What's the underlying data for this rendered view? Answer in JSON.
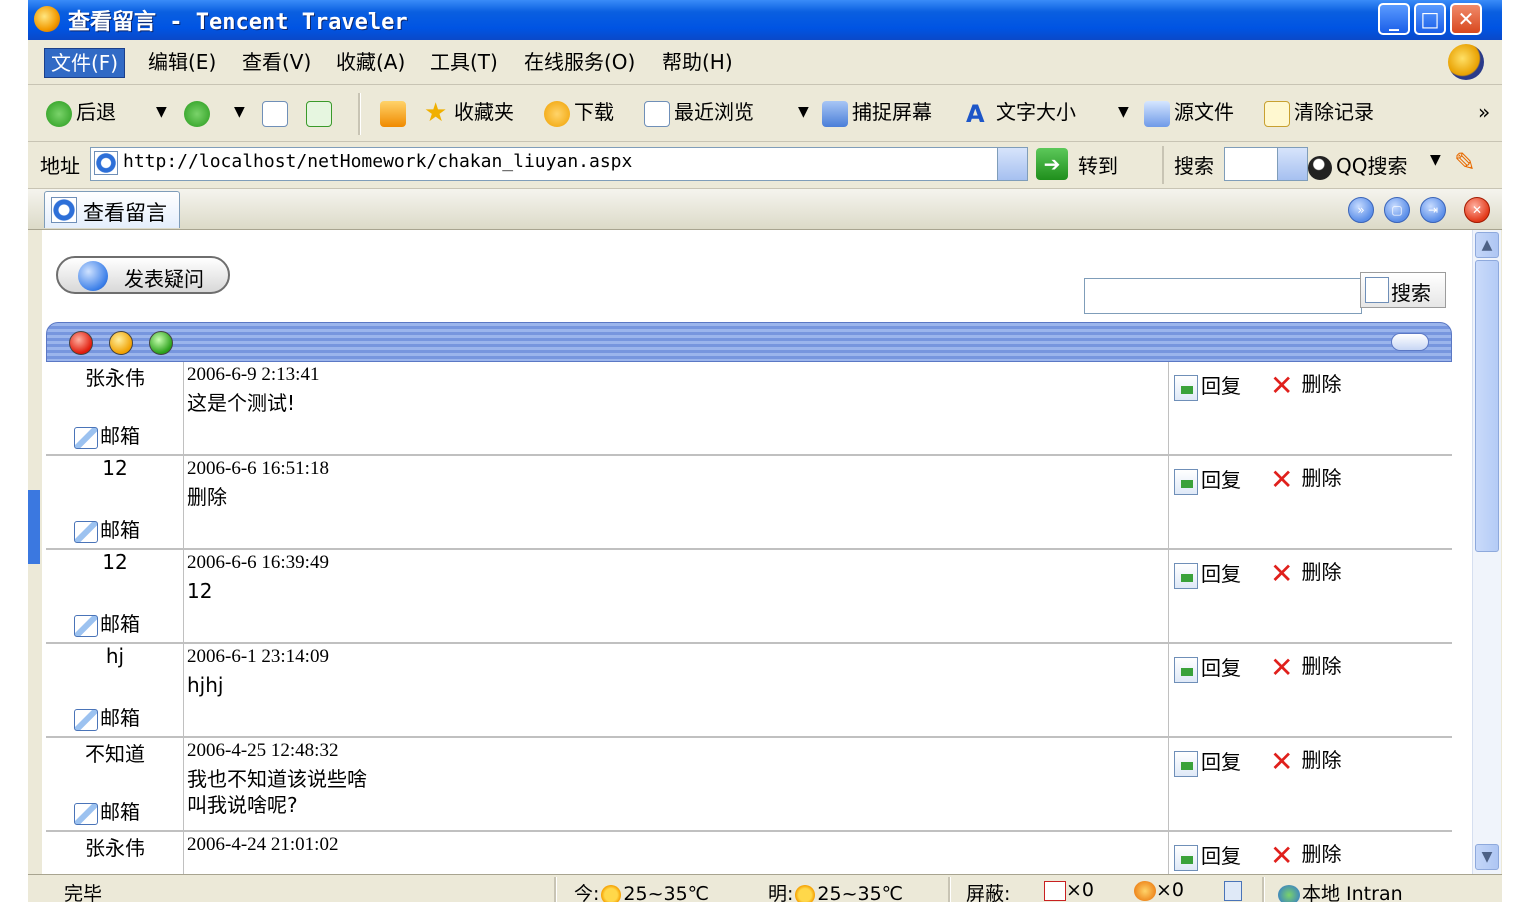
{
  "window": {
    "title": "查看留言 - Tencent Traveler"
  },
  "menu": {
    "items": [
      "文件(F)",
      "编辑(E)",
      "查看(V)",
      "收藏(A)",
      "工具(T)",
      "在线服务(O)",
      "帮助(H)"
    ]
  },
  "toolbar": {
    "back": "后退",
    "favorites": "收藏夹",
    "download": "下载",
    "recent": "最近浏览",
    "capture": "捕捉屏幕",
    "font_size": "文字大小",
    "source": "源文件",
    "clear": "清除记录",
    "more": "»"
  },
  "address": {
    "label": "地址",
    "url": "http://localhost/netHomework/chakan_liuyan.aspx",
    "go": "转到",
    "search_label": "搜索",
    "qq_search": "QQ搜索"
  },
  "tab": {
    "label": "查看留言"
  },
  "page": {
    "post_button": "发表疑问",
    "search_button": "搜索",
    "search_value": ""
  },
  "messages": [
    {
      "author": "张永伟",
      "date": "2006-6-9 2:13:41",
      "lines": [
        "这是个测试!"
      ]
    },
    {
      "author": "12",
      "date": "2006-6-6 16:51:18",
      "lines": [
        "删除"
      ]
    },
    {
      "author": "12",
      "date": "2006-6-6 16:39:49",
      "lines": [
        "12"
      ]
    },
    {
      "author": "hj",
      "date": "2006-6-1 23:14:09",
      "lines": [
        "hjhj"
      ]
    },
    {
      "author": "不知道",
      "date": "2006-4-25 12:48:32",
      "lines": [
        "我也不知道该说些啥",
        "叫我说啥呢?"
      ]
    },
    {
      "author": "张永伟",
      "date": "2006-4-24 21:01:02",
      "lines": []
    }
  ],
  "row_labels": {
    "mail": "邮箱",
    "reply": "回复",
    "delete": "删除"
  },
  "status": {
    "done": "完毕",
    "today_label": "今:",
    "today_temp": "25~35℃",
    "tomorrow_label": "明:",
    "tomorrow_temp": "25~35℃",
    "block_label": "屏蔽:",
    "block_popups": "×0",
    "block_ads": "×0",
    "zone": "本地 Intran"
  },
  "colors": {
    "title_bar": "#0054e3",
    "panel_header": "#7796de",
    "delete_x": "#e0201c"
  }
}
